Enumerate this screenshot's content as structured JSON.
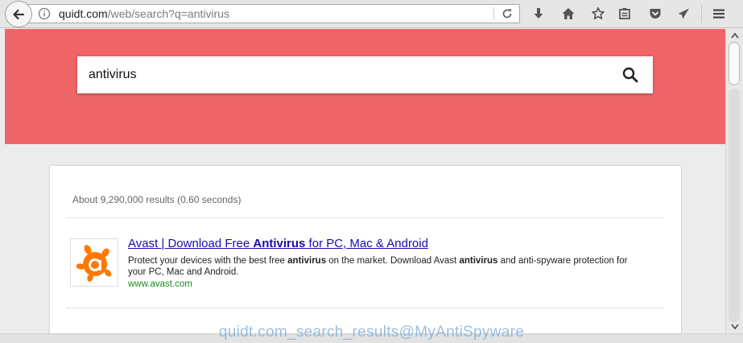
{
  "browser": {
    "url_host": "quidt.com",
    "url_path": "/web/search?q=antivirus"
  },
  "search": {
    "query": "antivirus"
  },
  "results": {
    "stats": "About 9,290,000 results (0.60 seconds)",
    "items": [
      {
        "title_pre": "Avast | Download Free ",
        "title_bold": "Antivirus",
        "title_post": " for PC, Mac & Android",
        "snippet_1": "Protect your devices with the best free ",
        "snippet_bold_1": "antivirus",
        "snippet_2": " on the market. Download Avast ",
        "snippet_bold_2": "antivirus",
        "snippet_3": " and anti-spyware protection for your PC, Mac and Android.",
        "url": "www.avast.com",
        "icon": "avast-logo-icon"
      }
    ]
  },
  "watermark": "quidt.com_search_results@MyAntiSpyware",
  "colors": {
    "hero": "#ef6567",
    "link": "#1a0dab",
    "url_green": "#1e8a1e",
    "avast_orange": "#ff7800"
  }
}
